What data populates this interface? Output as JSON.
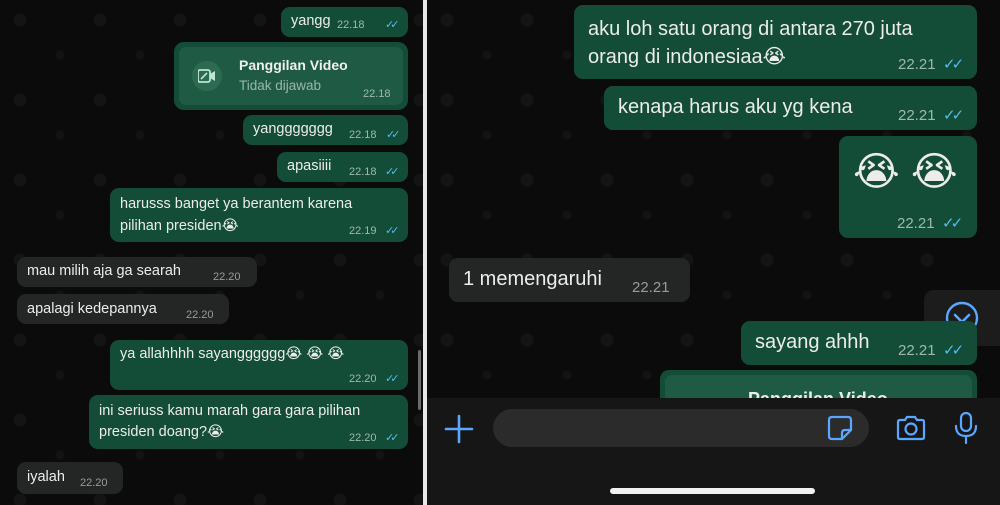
{
  "left": {
    "messages": [
      {
        "text": "yangg",
        "time": "22.18"
      },
      {
        "text": "yanggggggg",
        "time": "22.18"
      },
      {
        "text": "apasiiii",
        "time": "22.18"
      },
      {
        "line1": "harusss banget ya berantem karena",
        "line2": "pilihan presiden😭",
        "time": "22.19"
      },
      {
        "text": "mau milih aja ga searah",
        "time": "22.20"
      },
      {
        "text": "apalagi kedepannya",
        "time": "22.20"
      },
      {
        "text": "ya allahhhh sayangggggg😭 😭 😭",
        "time": "22.20"
      },
      {
        "line1": "ini seriuss kamu marah gara gara pilihan",
        "line2": "presiden doang?😭",
        "time": "22.20"
      },
      {
        "text": "iyalah",
        "time": "22.20"
      }
    ],
    "call": {
      "title": "Panggilan Video",
      "subtitle": "Tidak dijawab",
      "time": "22.18"
    }
  },
  "right": {
    "messages": [
      {
        "line1": "aku loh satu orang di antara 270 juta",
        "line2": "orang di indonesiaa😭",
        "time": "22.21"
      },
      {
        "text": "kenapa harus aku yg kena",
        "time": "22.21"
      },
      {
        "text": "😭 😭",
        "time": "22.21"
      },
      {
        "text": "1 memengaruhi",
        "time": "22.21"
      },
      {
        "text": "sayang ahhh",
        "time": "22.21"
      }
    ],
    "call_partial": {
      "title": "Panggilan Video"
    }
  },
  "icons": [
    "plus-icon",
    "sticker-icon",
    "camera-icon",
    "microphone-icon",
    "chevron-down-icon",
    "video-call-icon"
  ],
  "colors": {
    "outgoing": "#144d37",
    "incoming": "#242626",
    "accent": "#5aa7ff",
    "read_tick": "#53bdeb"
  }
}
